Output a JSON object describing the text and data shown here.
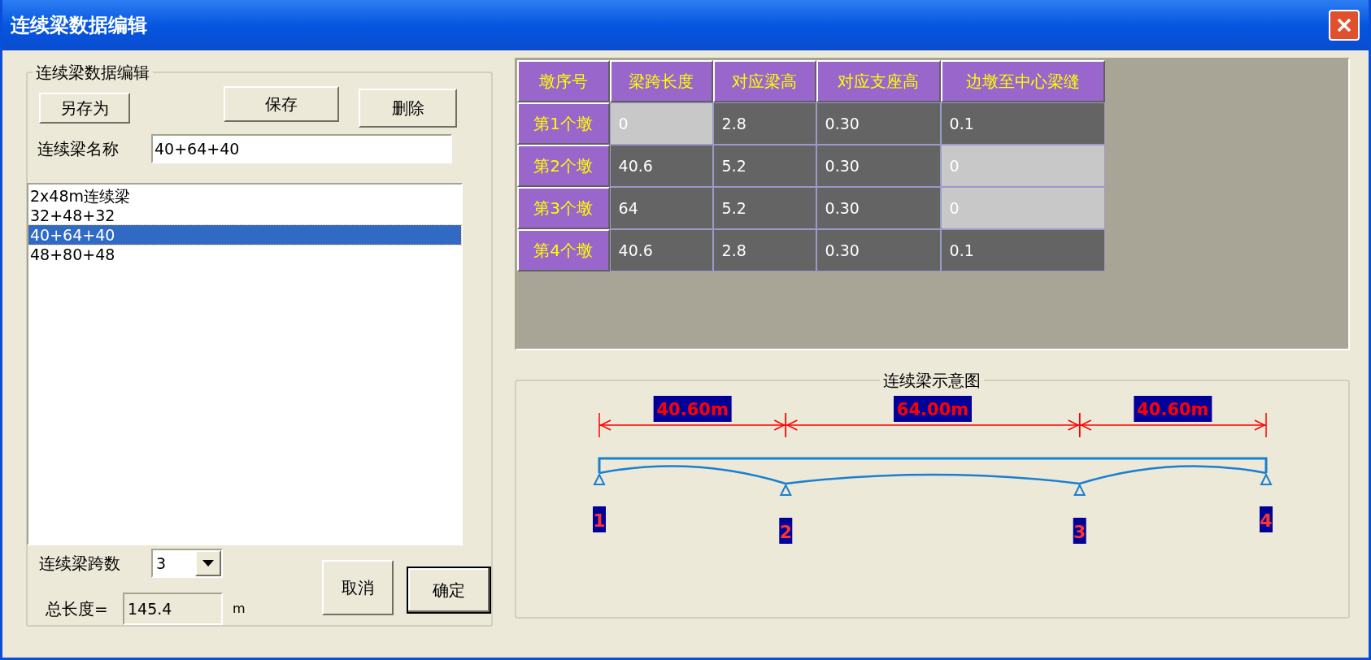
{
  "window": {
    "title": "连续梁数据编辑"
  },
  "editor": {
    "legend": "连续梁数据编辑",
    "buttons": [
      {
        "label": "另存为"
      },
      {
        "label": "保存"
      },
      {
        "label": "删除"
      }
    ],
    "name_label": "连续梁名称",
    "name_value": "40+64+40",
    "list": [
      {
        "label": "2x48m连续梁",
        "selected": false
      },
      {
        "label": "32+48+32",
        "selected": false
      },
      {
        "label": "40+64+40",
        "selected": true
      },
      {
        "label": "48+80+48",
        "selected": false
      }
    ],
    "span_count_label": "连续梁跨数",
    "span_count_value": "3",
    "total_label": "总长度=",
    "total_value": "145.4",
    "total_unit": "m",
    "actions": [
      {
        "label": "取消",
        "default": false
      },
      {
        "label": "确定",
        "default": true
      }
    ]
  },
  "table": {
    "columns": [
      "墩序号",
      "梁跨长度",
      "对应梁高",
      "对应支座高",
      "边墩至中心梁缝"
    ],
    "rows": [
      {
        "cells": [
          {
            "kind": "header",
            "value": "第1个墩"
          },
          {
            "value": "0",
            "disabled": true
          },
          {
            "value": "2.8",
            "disabled": false
          },
          {
            "value": "0.30",
            "disabled": false
          },
          {
            "value": "0.1",
            "disabled": false
          }
        ]
      },
      {
        "cells": [
          {
            "kind": "header",
            "value": "第2个墩"
          },
          {
            "value": "40.6",
            "disabled": false
          },
          {
            "value": "5.2",
            "disabled": false
          },
          {
            "value": "0.30",
            "disabled": false
          },
          {
            "value": "0",
            "disabled": true
          }
        ]
      },
      {
        "cells": [
          {
            "kind": "header",
            "value": "第3个墩"
          },
          {
            "value": "64",
            "disabled": false
          },
          {
            "value": "5.2",
            "disabled": false
          },
          {
            "value": "0.30",
            "disabled": false
          },
          {
            "value": "0",
            "disabled": true
          }
        ]
      },
      {
        "cells": [
          {
            "kind": "header",
            "value": "第4个墩"
          },
          {
            "value": "40.6",
            "disabled": false
          },
          {
            "value": "2.8",
            "disabled": false
          },
          {
            "value": "0.30",
            "disabled": false
          },
          {
            "value": "0.1",
            "disabled": false
          }
        ]
      }
    ]
  },
  "diagram": {
    "title": "连续梁示意图",
    "spans": [
      "40.60m",
      "64.00m",
      "40.60m"
    ],
    "supports": [
      "1",
      "2",
      "3",
      "4"
    ]
  }
}
